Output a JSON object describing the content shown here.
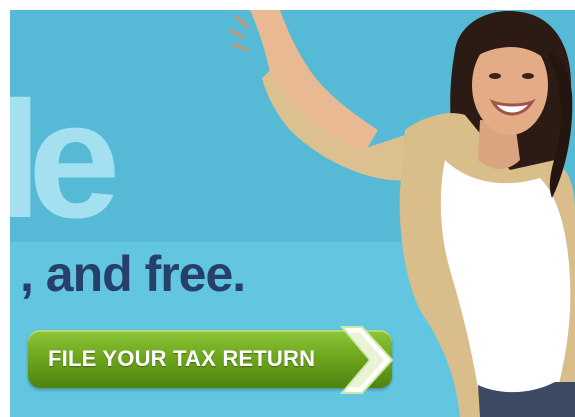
{
  "banner": {
    "headline_fragment": "le",
    "subline": ", and free.",
    "cta_label": "FILE YOUR TAX RETURN",
    "arrow_icon": "chevron-right-icon",
    "colors": {
      "background_top": "#56b9d6",
      "background_bottom": "#63c6e0",
      "headline": "#a5e0f1",
      "subline": "#26406a",
      "cta_green": "#6fa71e",
      "cta_text": "#ffffff"
    }
  }
}
